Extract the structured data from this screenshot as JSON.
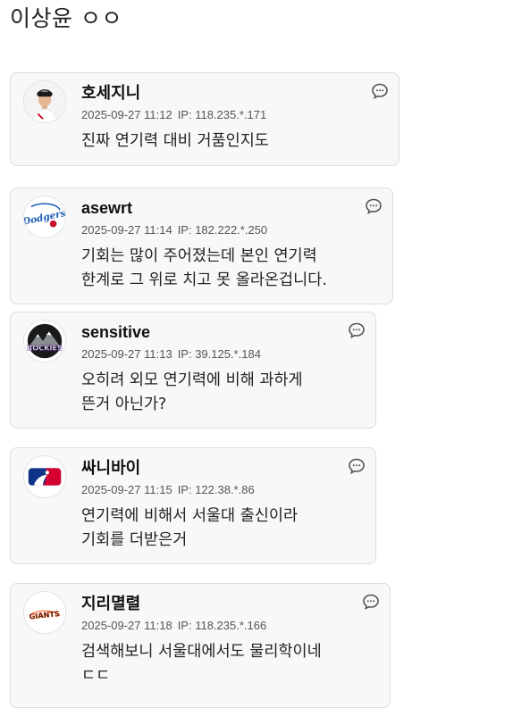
{
  "page": {
    "title": "이상윤 ㅇㅇ"
  },
  "comments": [
    {
      "nickname": "호세지니",
      "date": "2025-09-27 11:12",
      "ip": "IP: 118.235.*.171",
      "lines": [
        "진짜 연기력 대비 거품인지도"
      ],
      "avatar_icon": "baseball-player-photo-icon"
    },
    {
      "nickname": "asewrt",
      "date": "2025-09-27 11:14",
      "ip": "IP: 182.222.*.250",
      "lines": [
        "기회는 많이 주어졌는데 본인 연기력",
        "한계로 그 위로 치고 못 올라온겁니다."
      ],
      "avatar_icon": "dodgers-logo-icon",
      "avatar_text": "Dodgers"
    },
    {
      "nickname": "sensitive",
      "date": "2025-09-27 11:13",
      "ip": "IP: 39.125.*.184",
      "lines": [
        "오히려 외모 연기력에 비해 과하게",
        "뜬거 아닌가?"
      ],
      "avatar_icon": "rockies-logo-icon",
      "avatar_text": "ROCKIES"
    },
    {
      "nickname": "싸니바이",
      "date": "2025-09-27 11:15",
      "ip": "IP: 122.38.*.86",
      "lines": [
        "연기력에 비해서 서울대 출신이라",
        "기회를 더받은거"
      ],
      "avatar_icon": "mlb-logo-icon"
    },
    {
      "nickname": "지리멸렬",
      "date": "2025-09-27 11:18",
      "ip": "IP: 118.235.*.166",
      "lines": [
        "검색해보니 서울대에서도 물리학이네",
        "ㄷㄷ"
      ],
      "avatar_icon": "giants-logo-icon",
      "avatar_text": "GIANTS"
    }
  ],
  "reply_icon": "comment-bubble-icon",
  "colors": {
    "card_bg": "#f8f8f8",
    "card_border": "#dcdcdc",
    "dodgers_blue": "#1e5bb5",
    "rockies_purple": "#33006f",
    "mlb_blue": "#0e3386",
    "mlb_red": "#d50032",
    "giants_orange": "#fd5a1e"
  }
}
